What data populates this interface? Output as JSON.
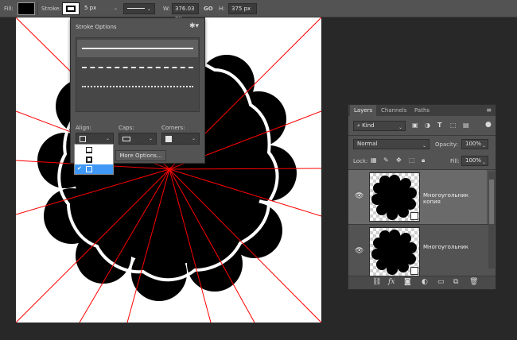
{
  "options_bar": {
    "fill_label": "Fill:",
    "stroke_label": "Stroke:",
    "stroke_width": "5 px",
    "w_label": "W:",
    "w_value": "376.03 px",
    "link_icon": "GO",
    "h_label": "H:",
    "h_value": "375 px",
    "fill_color": "#000000",
    "stroke_color": "#ffffff"
  },
  "stroke_options": {
    "title": "Stroke Options",
    "align_label": "Align:",
    "caps_label": "Caps:",
    "corners_label": "Corners:",
    "more_options": "More Options...",
    "presets": [
      "solid",
      "dashed",
      "dotted"
    ],
    "align_menu": [
      "inside",
      "center",
      "outside"
    ],
    "align_selected": "outside"
  },
  "layers_panel": {
    "tabs": [
      "Layers",
      "Channels",
      "Paths"
    ],
    "active_tab": "Layers",
    "filter_kind": "Kind",
    "blend_mode": "Normal",
    "opacity_label": "Opacity:",
    "opacity_value": "100%",
    "lock_label": "Lock:",
    "fill_label": "Fill:",
    "fill_value": "100%",
    "layers": [
      {
        "name": "Многоугольник копия",
        "selected": true,
        "visible": true
      },
      {
        "name": "Многоугольник",
        "selected": false,
        "visible": true
      }
    ],
    "bottom_icons": [
      "link-icon",
      "fx-icon",
      "mask-icon",
      "adjustment-icon",
      "folder-icon",
      "new-layer-icon",
      "trash-icon"
    ]
  },
  "canvas": {
    "background": "#ffffff",
    "shape_color": "#000000",
    "stroke_color": "#ffffff",
    "guide_color": "#ff0000"
  }
}
